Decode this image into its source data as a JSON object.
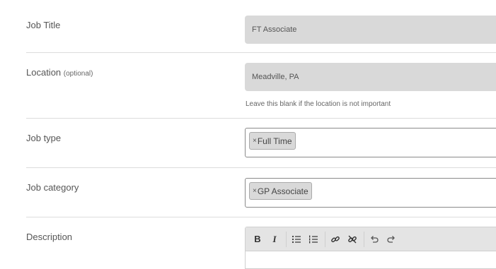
{
  "job_title": {
    "label": "Job Title",
    "value": "FT Associate"
  },
  "location": {
    "label": "Location",
    "optional_text": "(optional)",
    "value": "Meadville, PA",
    "help": "Leave this blank if the location is not important"
  },
  "job_type": {
    "label": "Job type",
    "tags": [
      {
        "remove": "×",
        "text": "Full Time"
      }
    ]
  },
  "job_category": {
    "label": "Job category",
    "tags": [
      {
        "remove": "×",
        "text": "GP Associate"
      }
    ]
  },
  "description": {
    "label": "Description",
    "toolbar": {
      "bold": "B",
      "italic": "I",
      "bullet_list_icon": "bullet-list-icon",
      "numbered_list_icon": "numbered-list-icon",
      "link_icon": "link-icon",
      "unlink_icon": "unlink-icon",
      "undo_icon": "undo-icon",
      "redo_icon": "redo-icon"
    }
  }
}
